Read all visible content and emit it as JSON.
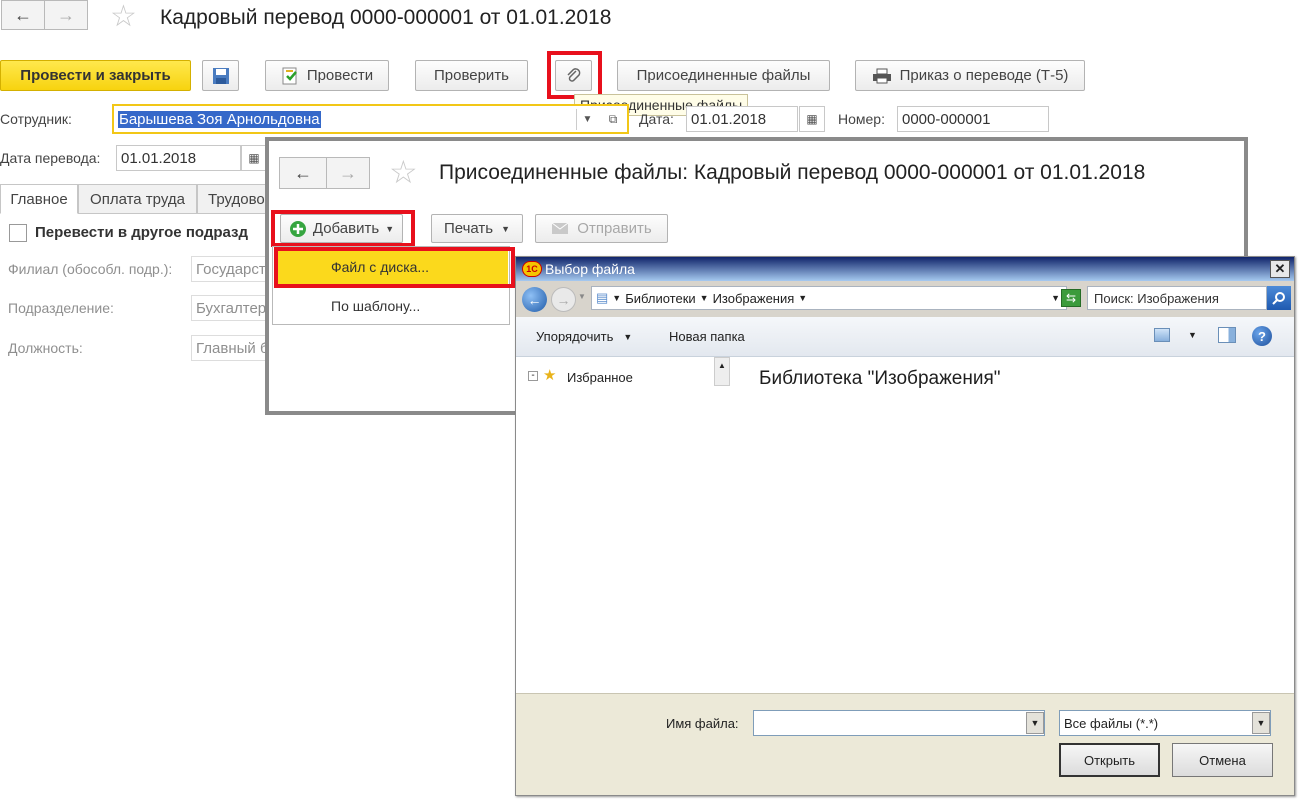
{
  "main": {
    "title": "Кадровый перевод 0000-000001 от 01.01.2018",
    "toolbar": {
      "post_close": "Провести и закрыть",
      "post": "Провести",
      "check": "Проверить",
      "attached_files": "Присоединенные файлы",
      "print_order": "Приказ о переводе (Т-5)"
    },
    "tooltip": "Присоединенные файлы",
    "employee_label": "Сотрудник:",
    "employee_value": "Барышева Зоя Арнольдовна",
    "date_label": "Дата:",
    "date_value": "01.01.2018",
    "number_label": "Номер:",
    "number_value": "0000-000001",
    "transfer_date_label": "Дата перевода:",
    "transfer_date_value": "01.01.2018",
    "tabs": [
      "Главное",
      "Оплата труда",
      "Трудово"
    ],
    "checkbox_label": "Перевести в другое подразд",
    "branch_label": "Филиал (обособл. подр.):",
    "branch_value": "Государств",
    "division_label": "Подразделение:",
    "division_value": "Бухгалтер",
    "position_label": "Должность:",
    "position_value": "Главный б"
  },
  "attached": {
    "title": "Присоединенные файлы: Кадровый перевод 0000-000001 от 01.01.2018",
    "add": "Добавить",
    "print": "Печать",
    "send": "Отправить",
    "menu": [
      "Файл с диска...",
      "По шаблону..."
    ]
  },
  "file_dialog": {
    "title": "Выбор файла",
    "logo": "1С",
    "breadcrumb": [
      "Библиотеки",
      "Изображения"
    ],
    "search_placeholder": "Поиск: Изображения",
    "organize": "Упорядочить",
    "new_folder": "Новая папка",
    "favorites": "Избранное",
    "library_heading": "Библиотека \"Изображения\"",
    "filename_label": "Имя файла:",
    "filename_value": "",
    "filter_value": "Все файлы (*.*)",
    "open": "Открыть",
    "cancel": "Отмена"
  },
  "colors": {
    "highlight_red": "#e8101c",
    "primary_yellow": "#f7d30f",
    "selection_blue": "#3568c9"
  }
}
